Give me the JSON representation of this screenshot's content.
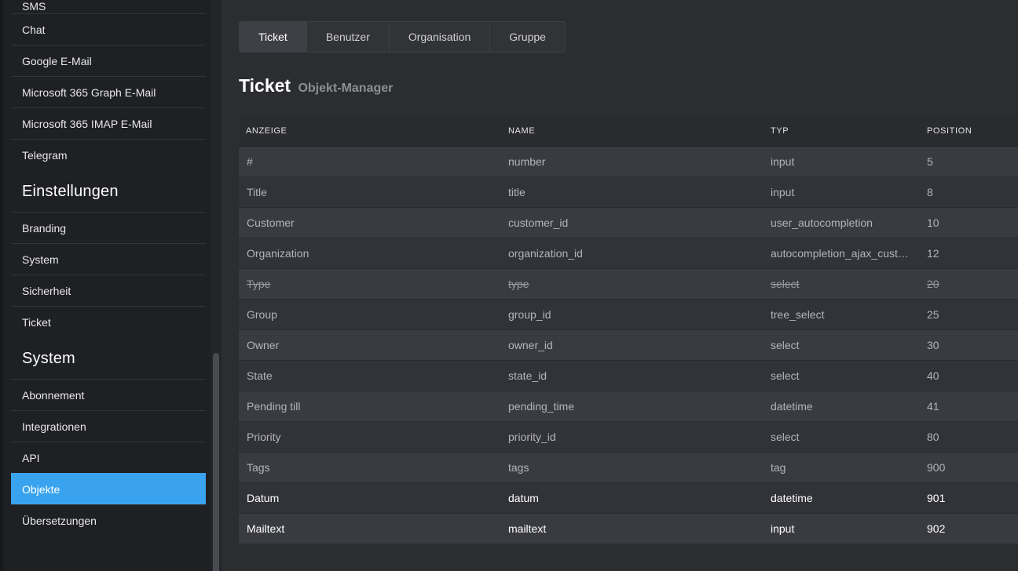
{
  "sidebar": {
    "items_top": [
      "SMS",
      "Chat",
      "Google E-Mail",
      "Microsoft 365 Graph E-Mail",
      "Microsoft 365 IMAP E-Mail",
      "Telegram"
    ],
    "sections": [
      {
        "heading": "Einstellungen",
        "items": [
          "Branding",
          "System",
          "Sicherheit",
          "Ticket"
        ]
      },
      {
        "heading": "System",
        "items": [
          "Abonnement",
          "Integrationen",
          "API",
          "Objekte",
          "Übersetzungen"
        ]
      }
    ],
    "active_item": "Objekte"
  },
  "tabs": [
    {
      "label": "Ticket",
      "active": true
    },
    {
      "label": "Benutzer",
      "active": false
    },
    {
      "label": "Organisation",
      "active": false
    },
    {
      "label": "Gruppe",
      "active": false
    }
  ],
  "page": {
    "title": "Ticket",
    "subtitle": "Objekt-Manager"
  },
  "table": {
    "headers": [
      "ANZEIGE",
      "NAME",
      "TYP",
      "POSITION"
    ],
    "rows": [
      {
        "display": "#",
        "name": "number",
        "type": "input",
        "position": "5",
        "style": "normal"
      },
      {
        "display": "Title",
        "name": "title",
        "type": "input",
        "position": "8",
        "style": "normal"
      },
      {
        "display": "Customer",
        "name": "customer_id",
        "type": "user_autocompletion",
        "position": "10",
        "style": "normal"
      },
      {
        "display": "Organization",
        "name": "organization_id",
        "type": "autocompletion_ajax_cust…",
        "position": "12",
        "style": "normal"
      },
      {
        "display": "Type",
        "name": "type",
        "type": "select",
        "position": "20",
        "style": "deleted"
      },
      {
        "display": "Group",
        "name": "group_id",
        "type": "tree_select",
        "position": "25",
        "style": "normal"
      },
      {
        "display": "Owner",
        "name": "owner_id",
        "type": "select",
        "position": "30",
        "style": "normal"
      },
      {
        "display": "State",
        "name": "state_id",
        "type": "select",
        "position": "40",
        "style": "normal"
      },
      {
        "display": "Pending till",
        "name": "pending_time",
        "type": "datetime",
        "position": "41",
        "style": "normal"
      },
      {
        "display": "Priority",
        "name": "priority_id",
        "type": "select",
        "position": "80",
        "style": "normal"
      },
      {
        "display": "Tags",
        "name": "tags",
        "type": "tag",
        "position": "900",
        "style": "normal"
      },
      {
        "display": "Datum",
        "name": "datum",
        "type": "datetime",
        "position": "901",
        "style": "bold"
      },
      {
        "display": "Mailtext",
        "name": "mailtext",
        "type": "input",
        "position": "902",
        "style": "bold"
      }
    ]
  },
  "colors": {
    "accent": "#3aa3f0",
    "background": "#2c2d31",
    "sidebar": "#1f2023"
  }
}
